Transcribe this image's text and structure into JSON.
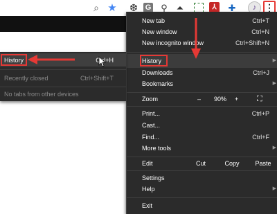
{
  "toolbar": {
    "icons": {
      "search": "search-icon",
      "bookmark": "star-icon",
      "ext1_glyph": "❆",
      "ext2_glyph": "G",
      "ext3_glyph": "⚲",
      "ext4_glyph": "⏶",
      "ext6_glyph": "⅄",
      "ext7_glyph": "✚",
      "avatar_glyph": "♪",
      "menu_glyph": "⋮"
    }
  },
  "menu": {
    "new_tab": {
      "label": "New tab",
      "shortcut": "Ctrl+T"
    },
    "new_window": {
      "label": "New window",
      "shortcut": "Ctrl+N"
    },
    "new_incognito": {
      "label": "New incognito window",
      "shortcut": "Ctrl+Shift+N"
    },
    "history": {
      "label": "History"
    },
    "downloads": {
      "label": "Downloads",
      "shortcut": "Ctrl+J"
    },
    "bookmarks": {
      "label": "Bookmarks"
    },
    "zoom": {
      "label": "Zoom",
      "minus": "–",
      "level": "90%",
      "plus": "+",
      "fullscreen": "⛶"
    },
    "print": {
      "label": "Print...",
      "shortcut": "Ctrl+P"
    },
    "cast": {
      "label": "Cast..."
    },
    "find": {
      "label": "Find...",
      "shortcut": "Ctrl+F"
    },
    "more_tools": {
      "label": "More tools"
    },
    "edit": {
      "label": "Edit",
      "cut": "Cut",
      "copy": "Copy",
      "paste": "Paste"
    },
    "settings": {
      "label": "Settings"
    },
    "help": {
      "label": "Help"
    },
    "exit": {
      "label": "Exit"
    },
    "submenu_arrow": "▶"
  },
  "submenu": {
    "history": {
      "label": "History",
      "shortcut": "Ctrl+H"
    },
    "recently_closed": {
      "label": "Recently closed",
      "shortcut": "Ctrl+Shift+T"
    },
    "no_tabs": {
      "label": "No tabs from other devices"
    }
  },
  "colors": {
    "menu_bg": "#2b2b2b",
    "highlight_border": "#e53935",
    "annotation_arrow": "#e53935"
  }
}
